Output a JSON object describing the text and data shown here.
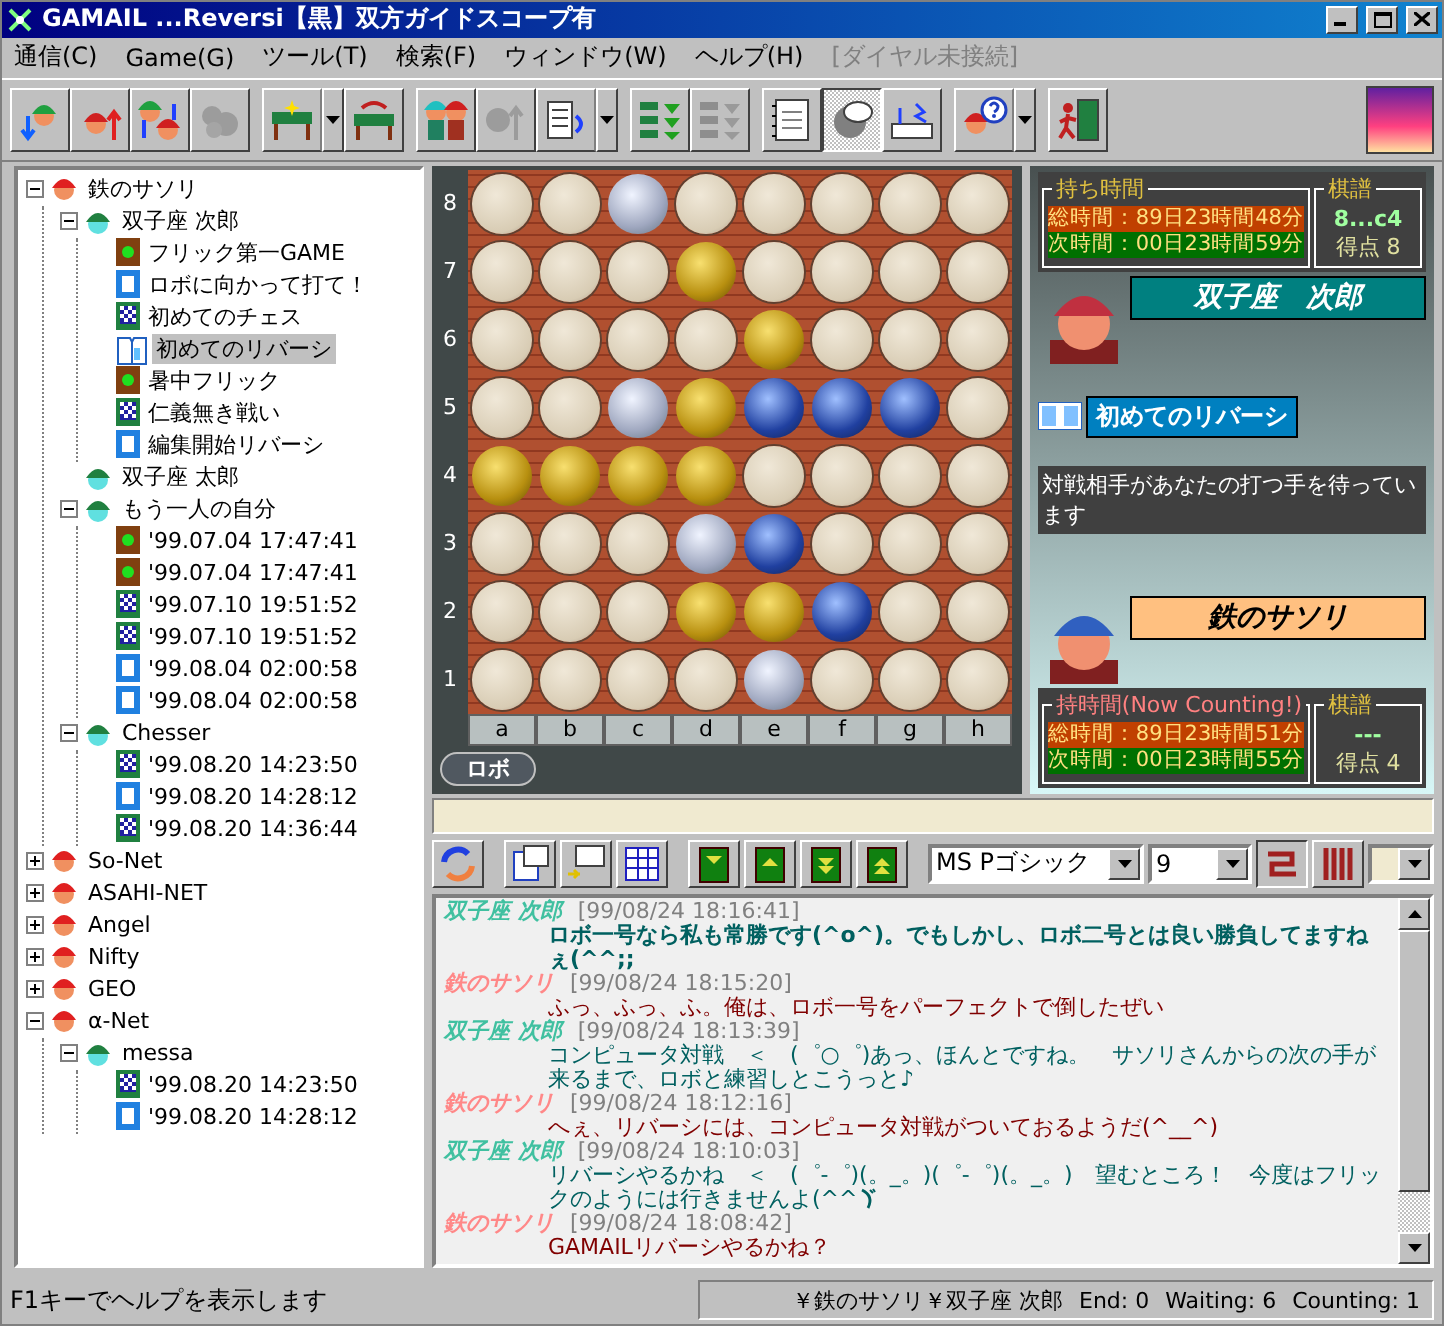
{
  "window": {
    "title": "GAMAIL ...Reversi【黒】双方ガイドスコープ有"
  },
  "menu": [
    {
      "label": "通信(C)",
      "disabled": false
    },
    {
      "label": "Game(G)",
      "disabled": false
    },
    {
      "label": "ツール(T)",
      "disabled": false
    },
    {
      "label": "検索(F)",
      "disabled": false
    },
    {
      "label": "ウィンドウ(W)",
      "disabled": false
    },
    {
      "label": "ヘルプ(H)",
      "disabled": false
    },
    {
      "label": "[ダイヤル未接続]",
      "disabled": true
    }
  ],
  "toolbar": [
    {
      "buttons": [
        {
          "kind": "receive",
          "disabled": false,
          "pressed": false,
          "dropdown": false
        },
        {
          "kind": "send",
          "disabled": false,
          "pressed": false,
          "dropdown": false
        },
        {
          "kind": "exchange",
          "disabled": false,
          "pressed": false,
          "dropdown": false
        },
        {
          "kind": "cloud",
          "disabled": true,
          "pressed": false,
          "dropdown": false
        }
      ]
    },
    {
      "buttons": [
        {
          "kind": "table-star",
          "disabled": false,
          "pressed": false,
          "dropdown": true
        },
        {
          "kind": "table-swap",
          "disabled": false,
          "pressed": false,
          "dropdown": false
        }
      ]
    },
    {
      "buttons": [
        {
          "kind": "players",
          "disabled": false,
          "pressed": false,
          "dropdown": false
        },
        {
          "kind": "person-arrow",
          "disabled": true,
          "pressed": false,
          "dropdown": false
        },
        {
          "kind": "book-arrow",
          "disabled": false,
          "pressed": false,
          "dropdown": true
        }
      ]
    },
    {
      "buttons": [
        {
          "kind": "stack",
          "disabled": false,
          "pressed": false,
          "dropdown": false
        },
        {
          "kind": "stack",
          "disabled": true,
          "pressed": false,
          "dropdown": false
        }
      ]
    },
    {
      "buttons": [
        {
          "kind": "notebook",
          "disabled": false,
          "pressed": false,
          "dropdown": false
        },
        {
          "kind": "thinking-head",
          "disabled": false,
          "pressed": true,
          "dropdown": false
        },
        {
          "kind": "modem",
          "disabled": false,
          "pressed": false,
          "dropdown": false
        }
      ]
    },
    {
      "buttons": [
        {
          "kind": "help",
          "disabled": false,
          "pressed": false,
          "dropdown": true
        }
      ]
    },
    {
      "buttons": [
        {
          "kind": "exit",
          "disabled": false,
          "pressed": false,
          "dropdown": false
        }
      ]
    }
  ],
  "tree": [
    {
      "label": "鉄のサソリ",
      "kind": "red-user",
      "expanded": true,
      "selected": false,
      "children": [
        {
          "label": "双子座 次郎",
          "kind": "green-user",
          "expanded": true,
          "selected": false,
          "children": [
            {
              "label": "フリック第一GAME",
              "kind": "flick",
              "selected": false
            },
            {
              "label": "ロボに向かって打て！",
              "kind": "robo",
              "selected": false
            },
            {
              "label": "初めてのチェス",
              "kind": "chess",
              "selected": false
            },
            {
              "label": "初めてのリバーシ",
              "kind": "reversi",
              "selected": true
            },
            {
              "label": "暑中フリック",
              "kind": "flick",
              "selected": false
            },
            {
              "label": "仁義無き戦い",
              "kind": "chess",
              "selected": false
            },
            {
              "label": "編集開始リバーシ",
              "kind": "robo",
              "selected": false
            }
          ]
        },
        {
          "label": "双子座 太郎",
          "kind": "green-user",
          "selected": false
        },
        {
          "label": "もう一人の自分",
          "kind": "green-user",
          "expanded": true,
          "selected": false,
          "children": [
            {
              "label": "'99.07.04 17:47:41",
              "kind": "flick",
              "selected": false
            },
            {
              "label": "'99.07.04 17:47:41",
              "kind": "flick",
              "selected": false
            },
            {
              "label": "'99.07.10 19:51:52",
              "kind": "chess",
              "selected": false
            },
            {
              "label": "'99.07.10 19:51:52",
              "kind": "chess",
              "selected": false
            },
            {
              "label": "'99.08.04 02:00:58",
              "kind": "robo",
              "selected": false
            },
            {
              "label": "'99.08.04 02:00:58",
              "kind": "robo",
              "selected": false
            }
          ]
        },
        {
          "label": "Chesser",
          "kind": "green-user",
          "expanded": true,
          "selected": false,
          "children": [
            {
              "label": "'99.08.20 14:23:50",
              "kind": "chess",
              "selected": false
            },
            {
              "label": "'99.08.20 14:28:12",
              "kind": "robo",
              "selected": false
            },
            {
              "label": "'99.08.20 14:36:44",
              "kind": "chess",
              "selected": false
            }
          ]
        }
      ]
    },
    {
      "label": "So-Net",
      "kind": "red-user",
      "expanded": false,
      "selected": false
    },
    {
      "label": "ASAHI-NET",
      "kind": "red-user",
      "expanded": false,
      "selected": false
    },
    {
      "label": "Angel",
      "kind": "red-user",
      "expanded": false,
      "selected": false
    },
    {
      "label": "Nifty",
      "kind": "red-user",
      "expanded": false,
      "selected": false
    },
    {
      "label": "GEO",
      "kind": "red-user",
      "expanded": false,
      "selected": false
    },
    {
      "label": "α-Net",
      "kind": "red-user",
      "expanded": true,
      "selected": false,
      "children": [
        {
          "label": "messa",
          "kind": "green-user",
          "expanded": true,
          "selected": false,
          "children": [
            {
              "label": "'99.08.20 14:23:50",
              "kind": "chess",
              "selected": false
            },
            {
              "label": "'99.08.20 14:28:12",
              "kind": "robo",
              "selected": false
            }
          ]
        }
      ]
    }
  ],
  "board": {
    "row_labels": [
      "8",
      "7",
      "6",
      "5",
      "4",
      "3",
      "2",
      "1"
    ],
    "column_labels": [
      "a",
      "b",
      "c",
      "d",
      "e",
      "f",
      "g",
      "h"
    ],
    "rows": [
      [
        {
          "kind": "empty"
        },
        {
          "kind": "empty"
        },
        {
          "kind": "hint"
        },
        {
          "kind": "empty"
        },
        {
          "kind": "empty"
        },
        {
          "kind": "empty"
        },
        {
          "kind": "empty"
        },
        {
          "kind": "empty"
        }
      ],
      [
        {
          "kind": "empty"
        },
        {
          "kind": "empty"
        },
        {
          "kind": "empty"
        },
        {
          "kind": "yellow"
        },
        {
          "kind": "empty"
        },
        {
          "kind": "empty"
        },
        {
          "kind": "empty"
        },
        {
          "kind": "empty"
        }
      ],
      [
        {
          "kind": "empty"
        },
        {
          "kind": "empty"
        },
        {
          "kind": "empty"
        },
        {
          "kind": "empty"
        },
        {
          "kind": "yellow"
        },
        {
          "kind": "empty"
        },
        {
          "kind": "empty"
        },
        {
          "kind": "empty"
        }
      ],
      [
        {
          "kind": "empty"
        },
        {
          "kind": "empty"
        },
        {
          "kind": "hint"
        },
        {
          "kind": "yellow"
        },
        {
          "kind": "blue"
        },
        {
          "kind": "blue"
        },
        {
          "kind": "blue"
        },
        {
          "kind": "empty"
        }
      ],
      [
        {
          "kind": "yellow"
        },
        {
          "kind": "yellow"
        },
        {
          "kind": "yellow"
        },
        {
          "kind": "yellow"
        },
        {
          "kind": "empty"
        },
        {
          "kind": "empty"
        },
        {
          "kind": "empty"
        },
        {
          "kind": "empty"
        }
      ],
      [
        {
          "kind": "empty"
        },
        {
          "kind": "empty"
        },
        {
          "kind": "empty"
        },
        {
          "kind": "hint"
        },
        {
          "kind": "blue"
        },
        {
          "kind": "empty"
        },
        {
          "kind": "empty"
        },
        {
          "kind": "empty"
        }
      ],
      [
        {
          "kind": "empty"
        },
        {
          "kind": "empty"
        },
        {
          "kind": "empty"
        },
        {
          "kind": "yellow"
        },
        {
          "kind": "yellow"
        },
        {
          "kind": "blue"
        },
        {
          "kind": "empty"
        },
        {
          "kind": "empty"
        }
      ],
      [
        {
          "kind": "empty"
        },
        {
          "kind": "empty"
        },
        {
          "kind": "empty"
        },
        {
          "kind": "empty"
        },
        {
          "kind": "hint"
        },
        {
          "kind": "empty"
        },
        {
          "kind": "empty"
        },
        {
          "kind": "empty"
        }
      ]
    ],
    "mode": "ロボ"
  },
  "players": [
    {
      "kind": "top",
      "time_label": "持ち時間",
      "total": "総時間：89日23時間48分",
      "next": "次時間：00日23時間59分",
      "record_label": "棋譜",
      "last_move": "8...c4",
      "score": "得点 8",
      "name": "双子座　次郎",
      "color": "#c03040"
    },
    {
      "kind": "bottom",
      "time_label": "持時間(Now Counting!)",
      "total": "総時間：89日23時間51分",
      "next": "次時間：00日23時間55分",
      "record_label": "棋譜",
      "last_move": "---",
      "score": "得点 4",
      "name": "鉄のサソリ",
      "color": "#3060c0"
    }
  ],
  "game_title": "初めてのリバーシ",
  "status_message": "対戦相手があなたの打つ手を待っています",
  "chat_toolbar": {
    "font": "MS Pゴシック",
    "size": "9"
  },
  "chat": [
    {
      "sender": "双子座 次郎",
      "kind": "self",
      "time": "[99/08/24 18:16:41]",
      "text": "ロボ一号なら私も常勝です(^o^)。でもしかし、ロボ二号とは良い勝負してますねぇ(^^;;",
      "bold": true,
      "iteration_mark": false
    },
    {
      "sender": "鉄のサソリ",
      "kind": "opponent",
      "time": "[99/08/24 18:15:20]",
      "text": "ふっ、ふっ、ふ。俺は、ロボ一号をパーフェクトで倒したぜい",
      "bold": false,
      "iteration_mark": false
    },
    {
      "sender": "双子座 次郎",
      "kind": "self",
      "time": "[99/08/24 18:13:39]",
      "text": "コンピュータ対戦　＜　(゜○゜)あっ、ほんとですね。　サソリさんからの次の手が来るまで、ロボと練習しとこうっと♪",
      "bold": false,
      "iteration_mark": false
    },
    {
      "sender": "鉄のサソリ",
      "kind": "opponent",
      "time": "[99/08/24 18:12:16]",
      "text": "へぇ、リバーシには、コンピュータ対戦がついておるようだ(^__^)",
      "bold": false,
      "iteration_mark": false
    },
    {
      "sender": "双子座 次郎",
      "kind": "self",
      "time": "[99/08/24 18:10:03]",
      "text": "リバーシやるかね　＜　(゜-゜)(。_。)(゜-゜)(。_。)　望むところ！　今度はフリックのようには行きませんよ(^^",
      "bold": false,
      "iteration_mark": true
    },
    {
      "sender": "鉄のサソリ",
      "kind": "opponent",
      "time": "[99/08/24 18:08:42]",
      "text": "GAMAILリバーシやるかね？",
      "bold": false,
      "iteration_mark": false
    }
  ],
  "status_bar": {
    "help": "F1キーでヘルプを表示します",
    "users": "￥鉄のサソリ￥双子座 次郎",
    "end": "End: 0",
    "waiting": "Waiting: 6",
    "counting": "Counting: 1"
  }
}
